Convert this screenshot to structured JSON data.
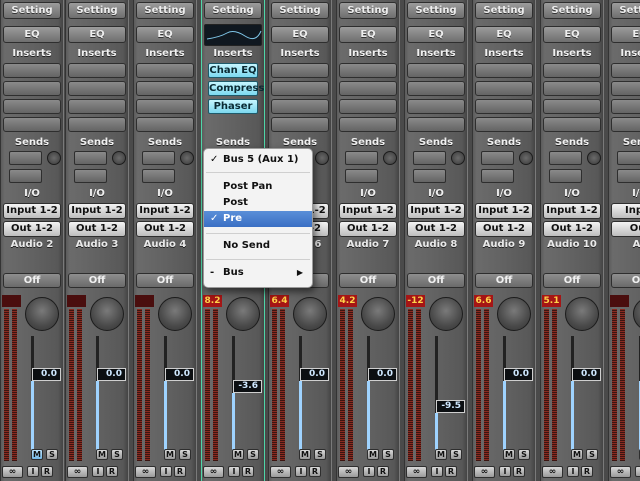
{
  "strips": [
    {
      "id": "s0",
      "name": "Audio 2",
      "setting": "Setting",
      "eq": "EQ",
      "inserts": "Inserts",
      "sends": "Sends",
      "io": "I/O",
      "input": "Input 1-2",
      "output": "Out 1-2",
      "auto": "Off",
      "peak": "",
      "fader": "0.0"
    },
    {
      "id": "s1",
      "name": "Audio 3",
      "setting": "Setting",
      "eq": "EQ",
      "inserts": "Inserts",
      "sends": "Sends",
      "io": "I/O",
      "input": "Input 1-2",
      "output": "Out 1-2",
      "auto": "Off",
      "peak": "",
      "fader": "0.0"
    },
    {
      "id": "s2",
      "name": "Audio 4",
      "setting": "Setting",
      "eq": "EQ",
      "inserts": "Inserts",
      "sends": "Sends",
      "io": "I/O",
      "input": "Input 1-2",
      "output": "Out 1-2",
      "auto": "Off",
      "peak": "",
      "fader": "0.0"
    },
    {
      "id": "s3",
      "name": "",
      "setting": "Setting",
      "eq": "",
      "inserts": "Inserts",
      "sends": "Sends",
      "io": "",
      "input": "",
      "output": "",
      "auto": "Off",
      "peak": "8.2",
      "fader": "-3.6",
      "plugins": [
        "Chan EQ",
        "Compress",
        "Phaser"
      ]
    },
    {
      "id": "s4",
      "name": "Audio 6",
      "setting": "Setting",
      "eq": "EQ",
      "inserts": "Inserts",
      "sends": "Sends",
      "io": "I/O",
      "input": "Input 1-2",
      "output": "Out 1-2",
      "auto": "Off",
      "peak": "6.4",
      "fader": "0.0"
    },
    {
      "id": "s5",
      "name": "Audio 7",
      "setting": "Setting",
      "eq": "EQ",
      "inserts": "Inserts",
      "sends": "Sends",
      "io": "I/O",
      "input": "Input 1-2",
      "output": "Out 1-2",
      "auto": "Off",
      "peak": "4.2",
      "fader": "0.0"
    },
    {
      "id": "s6",
      "name": "Audio 8",
      "setting": "Setting",
      "eq": "EQ",
      "inserts": "Inserts",
      "sends": "Sends",
      "io": "I/O",
      "input": "Input 1-2",
      "output": "Out 1-2",
      "auto": "Off",
      "peak": "-12",
      "fader": "-9.5"
    },
    {
      "id": "s7",
      "name": "Audio 9",
      "setting": "Setting",
      "eq": "EQ",
      "inserts": "Inserts",
      "sends": "Sends",
      "io": "I/O",
      "input": "Input 1-2",
      "output": "Out 1-2",
      "auto": "Off",
      "peak": "6.6",
      "fader": "0.0"
    },
    {
      "id": "s8",
      "name": "Audio 10",
      "setting": "Setting",
      "eq": "EQ",
      "inserts": "Inserts",
      "sends": "Sends",
      "io": "I/O",
      "input": "Input 1-2",
      "output": "Out 1-2",
      "auto": "Off",
      "peak": "5.1",
      "fader": "0.0"
    },
    {
      "id": "s9",
      "name": "Au",
      "setting": "Setting",
      "eq": "EQ",
      "inserts": "Inserts",
      "sends": "Sends",
      "io": "I/O",
      "input": "Input",
      "output": "Out",
      "auto": "Off",
      "peak": "",
      "fader": "0.0"
    }
  ],
  "buttons": {
    "mute": "M",
    "solo": "S",
    "input_monitor": "I",
    "record": "R",
    "link": "∞"
  },
  "popup": {
    "items": [
      {
        "check": "✓",
        "label": "Bus 5  (Aux 1)",
        "highlight": false
      },
      {
        "check": "",
        "label": "Post Pan",
        "highlight": false
      },
      {
        "check": "",
        "label": "Post",
        "highlight": false
      },
      {
        "check": "✓",
        "label": "Pre",
        "highlight": true
      },
      {
        "check": "",
        "label": "No Send",
        "highlight": false
      },
      {
        "check": "-",
        "label": "Bus",
        "highlight": false,
        "submenu": "▶"
      }
    ]
  },
  "colors": {
    "selected_outline": "#4fd6a8",
    "plugin_slot": "#9fe3f5",
    "meter": "#8a2a20"
  }
}
